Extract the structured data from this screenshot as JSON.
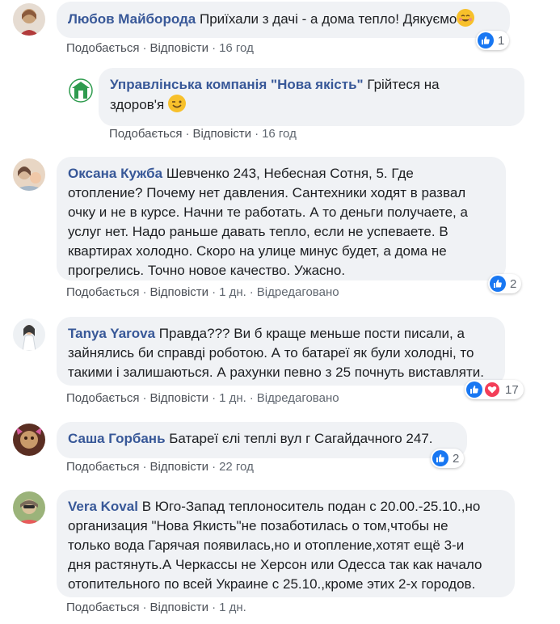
{
  "comments": [
    {
      "author": "Любов Майборода",
      "text": "Приїхали з дачі - а дома тепло! Дякуємо",
      "like_label": "Подобається",
      "reply_label": "Відповісти",
      "time": "16 год",
      "reactions": "1",
      "avatar_colors": [
        "#c9a27a",
        "#8b5a3c"
      ]
    },
    {
      "author": "Управлінська компанія \"Нова якість\"",
      "text_line1": "Грійтеся на",
      "text_line2": "здоров'я",
      "like_label": "Подобається",
      "reply_label": "Відповісти",
      "time": "16 год",
      "avatar_colors": [
        "#2e9b4e",
        "#ffffff"
      ]
    },
    {
      "author": "Оксана Кужба",
      "text_lines": [
        "Шевченко 243, Небесная Сотня, 5. Где",
        "отопление? Почему нет давления. Сантехники ходят в развал",
        "очку и не в курсе. Начни те работать. А то деньги получаете, а",
        "услуг нет. Надо раньше давать тепло, если не успеваете. В",
        "квартирах холодно. Скоро на улице минус будет, а дома не",
        "прогрелись. Точно новое качество. Ужасно."
      ],
      "like_label": "Подобається",
      "reply_label": "Відповісти",
      "time": "1 дн.",
      "edited": "Відредаговано",
      "reactions": "2",
      "avatar_colors": [
        "#d8b89a",
        "#6a4a3a"
      ]
    },
    {
      "author": "Tanya Yarova",
      "text_lines": [
        "Правда??? Ви б краще меньше пости писали, а",
        "зайнялись би справді роботою. А то батареї як були холодні, то",
        "такими і залишаються. А рахунки певно з 25 почнуть виставляти."
      ],
      "like_label": "Подобається",
      "reply_label": "Відповісти",
      "time": "1 дн.",
      "edited": "Відредаговано",
      "reactions": "17",
      "avatar_colors": [
        "#e8ecf0",
        "#3a3a3a"
      ]
    },
    {
      "author": "Саша Горбань",
      "text": "Батареї єлі теплі вул г Сагайдачного 247.",
      "like_label": "Подобається",
      "reply_label": "Відповісти",
      "time": "22 год",
      "reactions": "2",
      "avatar_colors": [
        "#7a3f2a",
        "#c99a6a"
      ]
    },
    {
      "author": "Vera Koval",
      "text_lines": [
        "В Юго-Запад теплоноситель подан с 20.00.-25.10.,но",
        "организация \"Нова Якисть\"не позаботилась о том,чтобы не",
        "только вода Гарячая появилась,но и отопление,хотят ещё 3-и",
        "дня растянуть.А Черкассы не Херсон или Одесса так как начало",
        "отопительного по всей Украине с 25.10.,кроме этих 2-х городов."
      ],
      "like_label": "Подобається",
      "reply_label": "Відповісти",
      "time": "1 дн.",
      "avatar_colors": [
        "#9bb37a",
        "#d9c29a"
      ]
    }
  ],
  "colors": {
    "author": "#385898",
    "bubble": "#f0f2f5",
    "meta": "#606770",
    "like_blue": "#1877f2",
    "love_red": "#f33e58"
  },
  "icons": {
    "like": "thumbs-up-icon",
    "love": "heart-icon",
    "emoji_blush": "smiling-face-icon",
    "emoji_wink": "winking-face-icon"
  }
}
